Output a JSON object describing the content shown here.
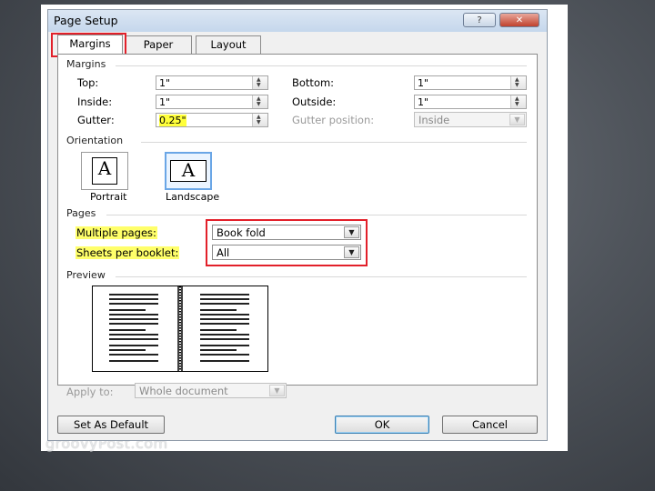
{
  "dialog": {
    "title": "Page Setup",
    "help_label": "?",
    "close_label": "✕"
  },
  "tabs": [
    {
      "label": "Margins",
      "active": true
    },
    {
      "label": "Paper",
      "active": false
    },
    {
      "label": "Layout",
      "active": false
    }
  ],
  "margins": {
    "section": "Margins",
    "top_label": "Top:",
    "top_value": "1\"",
    "inside_label": "Inside:",
    "inside_value": "1\"",
    "gutter_label": "Gutter:",
    "gutter_value": "0.25\"",
    "bottom_label": "Bottom:",
    "bottom_value": "1\"",
    "outside_label": "Outside:",
    "outside_value": "1\"",
    "gutter_position_label": "Gutter position:",
    "gutter_position_value": "Inside"
  },
  "orientation": {
    "section": "Orientation",
    "portrait_label": "Portrait",
    "landscape_label": "Landscape",
    "glyph": "A",
    "selected": "landscape"
  },
  "pages": {
    "section": "Pages",
    "multiple_label": "Multiple pages:",
    "multiple_value": "Book fold",
    "sheets_label": "Sheets per booklet:",
    "sheets_value": "All"
  },
  "preview": {
    "section": "Preview"
  },
  "apply": {
    "label": "Apply to:",
    "value": "Whole document"
  },
  "buttons": {
    "default_label": "Set As Default",
    "ok_label": "OK",
    "cancel_label": "Cancel"
  },
  "watermark": "groovyPost.com",
  "colors": {
    "highlight": "#ffff6a",
    "annotation_red": "#e2202a",
    "selection_blue": "#6aa6e6"
  },
  "icons": [
    "spin-up-icon",
    "spin-down-icon",
    "dropdown-arrow-icon",
    "help-icon",
    "close-icon"
  ]
}
